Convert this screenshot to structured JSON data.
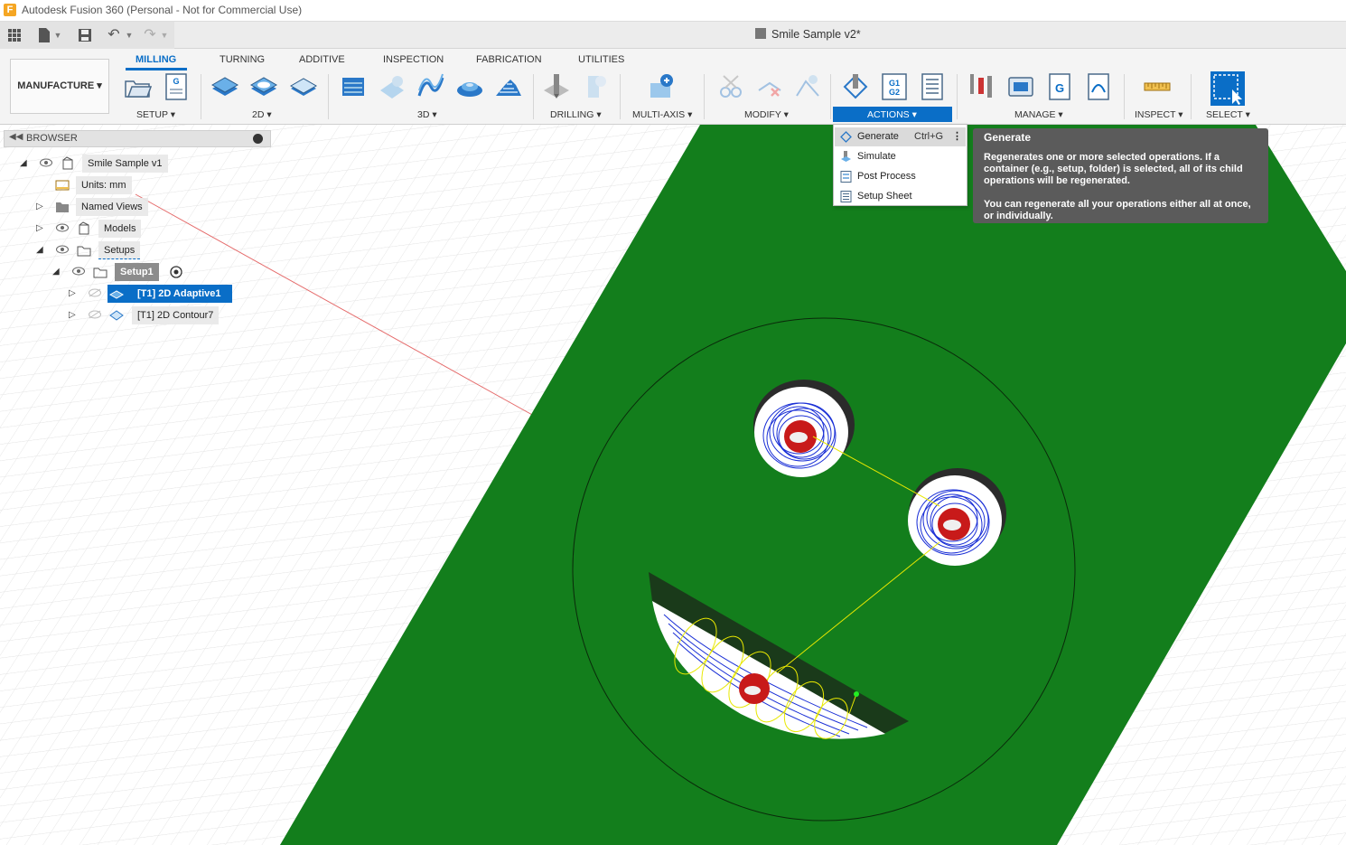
{
  "app": {
    "title": "Autodesk Fusion 360 (Personal - Not for Commercial Use)",
    "icon_letter": "F"
  },
  "document": {
    "tab_title": "Smile Sample v2*"
  },
  "ribbon": {
    "workspace": "MANUFACTURE",
    "tabs": [
      "MILLING",
      "TURNING",
      "ADDITIVE",
      "INSPECTION",
      "FABRICATION",
      "UTILITIES"
    ],
    "groups": [
      "SETUP",
      "2D",
      "3D",
      "DRILLING",
      "MULTI-AXIS",
      "MODIFY",
      "ACTIONS",
      "MANAGE",
      "INSPECT",
      "SELECT"
    ],
    "nc_icon_text": "G1 G2",
    "g_icon_text": "G"
  },
  "browser": {
    "title": "BROWSER",
    "items": [
      {
        "label": "Smile Sample v1"
      },
      {
        "label": "Units: mm"
      },
      {
        "label": "Named Views"
      },
      {
        "label": "Models"
      },
      {
        "label": "Setups"
      },
      {
        "label": "Setup1"
      },
      {
        "label": "[T1] 2D Adaptive1"
      },
      {
        "label": "[T1] 2D Contour7"
      }
    ]
  },
  "actions_menu": {
    "items": [
      {
        "label": "Generate",
        "shortcut": "Ctrl+G",
        "more": "⋮"
      },
      {
        "label": "Simulate"
      },
      {
        "label": "Post Process"
      },
      {
        "label": "Setup Sheet"
      }
    ]
  },
  "tooltip": {
    "title": "Generate",
    "body": "Regenerates one or more selected operations. If a container (e.g., setup, folder) is selected, all of its child operations will be regenerated.",
    "body2": "You can regenerate all your operations either all at once, or individually."
  },
  "colors": {
    "accent": "#0a6ec7",
    "stock_green": "#137e1c",
    "toolpath_blue": "#1a2fd6",
    "toolpath_yellow": "#e8e800",
    "tool_red": "#c81a1a"
  }
}
